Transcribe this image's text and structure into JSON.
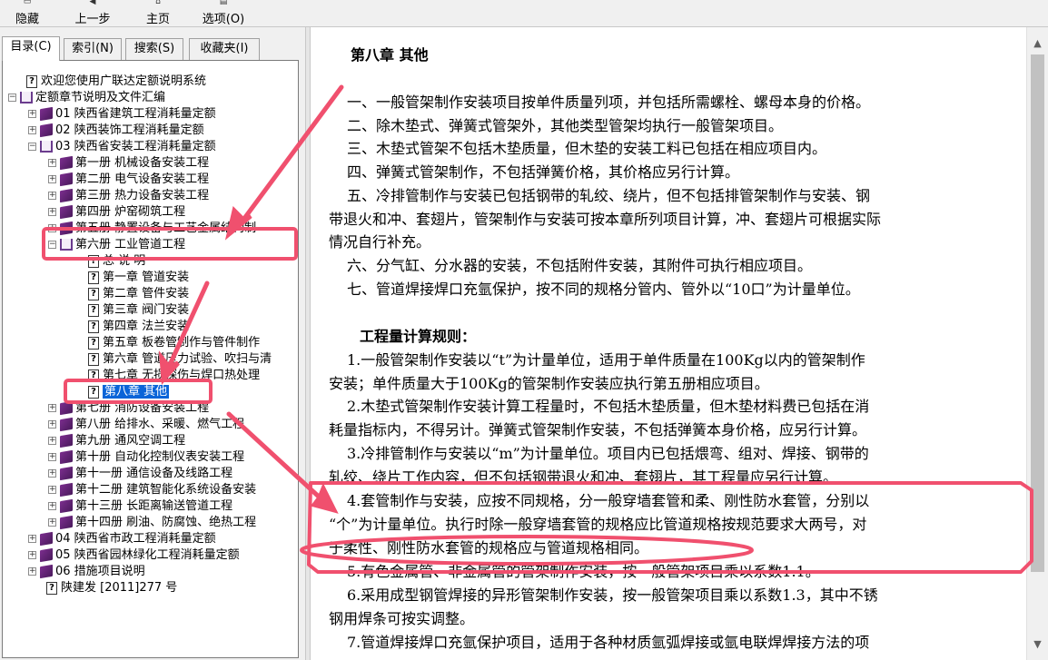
{
  "toolbar": {
    "hide_label": "隐藏",
    "back_label": "上一步",
    "home_label": "主页",
    "options_label": "选项(O)"
  },
  "tabs": {
    "contents": "目录(C)",
    "index": "索引(N)",
    "search": "搜索(S)",
    "favorites": "收藏夹(I)"
  },
  "tree": {
    "welcome": "欢迎您使用广联达定额说明系统",
    "root": "定额章节说明及文件汇编",
    "n01": "01 陕西省建筑工程消耗量定额",
    "n02": "02 陕西装饰工程消耗量定额",
    "n03": "03 陕西省安装工程消耗量定额",
    "b1": "第一册 机械设备安装工程",
    "b2": "第二册 电气设备安装工程",
    "b3": "第三册 热力设备安装工程",
    "b4": "第四册 炉窑砌筑工程",
    "b5": "第五册 静置设备与工艺金属结构制",
    "b6": "第六册 工业管道工程",
    "c0": "总 说 明",
    "c1": "第一章 管道安装",
    "c2": "第二章 管件安装",
    "c3": "第三章 阀门安装",
    "c4": "第四章 法兰安装",
    "c5": "第五章 板卷管制作与管件制作",
    "c6": "第六章 管道压力试验、吹扫与清",
    "c7": "第七章 无损探伤与焊口热处理",
    "c8": "第八章  其他",
    "b7": "第七册 消防设备安装工程",
    "b8": "第八册 给排水、采暖、燃气工程",
    "b9": "第九册 通风空调工程",
    "b10": "第十册 自动化控制仪表安装工程",
    "b11": "第十一册 通信设备及线路工程",
    "b12": "第十二册 建筑智能化系统设备安装",
    "b13": "第十三册 长距离输送管道工程",
    "b14": "第十四册 刷油、防腐蚀、绝热工程",
    "n04": "04 陕西省市政工程消耗量定额",
    "n05": "05 陕西省园林绿化工程消耗量定额",
    "n06": "06 措施项目说明",
    "doc": "陕建发 [2011]277 号"
  },
  "content": {
    "title": "第八章  其他",
    "l1": "一、一般管架制作安装项目按单件质量列项，并包括所需螺栓、螺母本身的价格。",
    "l2": "二、除木垫式、弹簧式管架外，其他类型管架均执行一般管架项目。",
    "l3": "三、木垫式管架不包括木垫质量，但木垫的安装工料已包括在相应项目内。",
    "l4": "四、弹簧式管架制作，不包括弹簧价格，其价格应另行计算。",
    "l5a": "五、冷排管制作与安装已包括钢带的轧绞、绕片，但不包括排管架制作与安装、钢",
    "l5b": "带退火和冲、套翅片，管架制作与安装可按本章所列项目计算，冲、套翅片可根据实际",
    "l5c": "情况自行补充。",
    "l6": "六、分气缸、分水器的安装，不包括附件安装，其附件可执行相应项目。",
    "l7": "七、管道焊接焊口充氩保护，按不同的规格分管内、管外以“10口”为计量单位。",
    "rules_title": "工程量计算规则：",
    "r1a": "1.一般管架制作安装以“t”为计量单位，适用于单件质量在100Kg以内的管架制作",
    "r1b": "安装；单件质量大于100Kg的管架制作安装应执行第五册相应项目。",
    "r2a": "2.木垫式管架制作安装计算工程量时，不包括木垫质量，但木垫材料费已包括在消",
    "r2b": "耗量指标内，不得另计。弹簧式管架制作安装，不包括弹簧本身价格，应另行计算。",
    "r3a": "3.冷排管制作与安装以“m”为计量单位。项目内已包括煨弯、组对、焊接、钢带的",
    "r3b": "轧绞、绕片工作内容，但不包括钢带退火和冲、套翅片，其工程量应另行计算。",
    "r4a": "4.套管制作与安装，应按不同规格，分一般穿墙套管和柔、刚性防水套管，分别以",
    "r4b": "“个”为计量单位。执行时除一般穿墙套管的规格应比管道规格按规范要求大两号，对",
    "r4c": "于柔性、刚性防水套管的规格应与管道规格相同。",
    "r5": "5.有色金属管、非金属管的管架制作安装，按一般管架项目乘以系数1.1。",
    "r6a": "6.采用成型钢管焊接的异形管架制作安装，按一般管架项目乘以系数1.3，其中不锈",
    "r6b": "钢用焊条可按实调整。",
    "r7": "7.管道焊接焊口充氩保护项目，适用于各种材质氩弧焊接或氩电联焊焊接方法的项"
  },
  "annotation_color": "#f0506e",
  "selection_color": "#0a64d8"
}
